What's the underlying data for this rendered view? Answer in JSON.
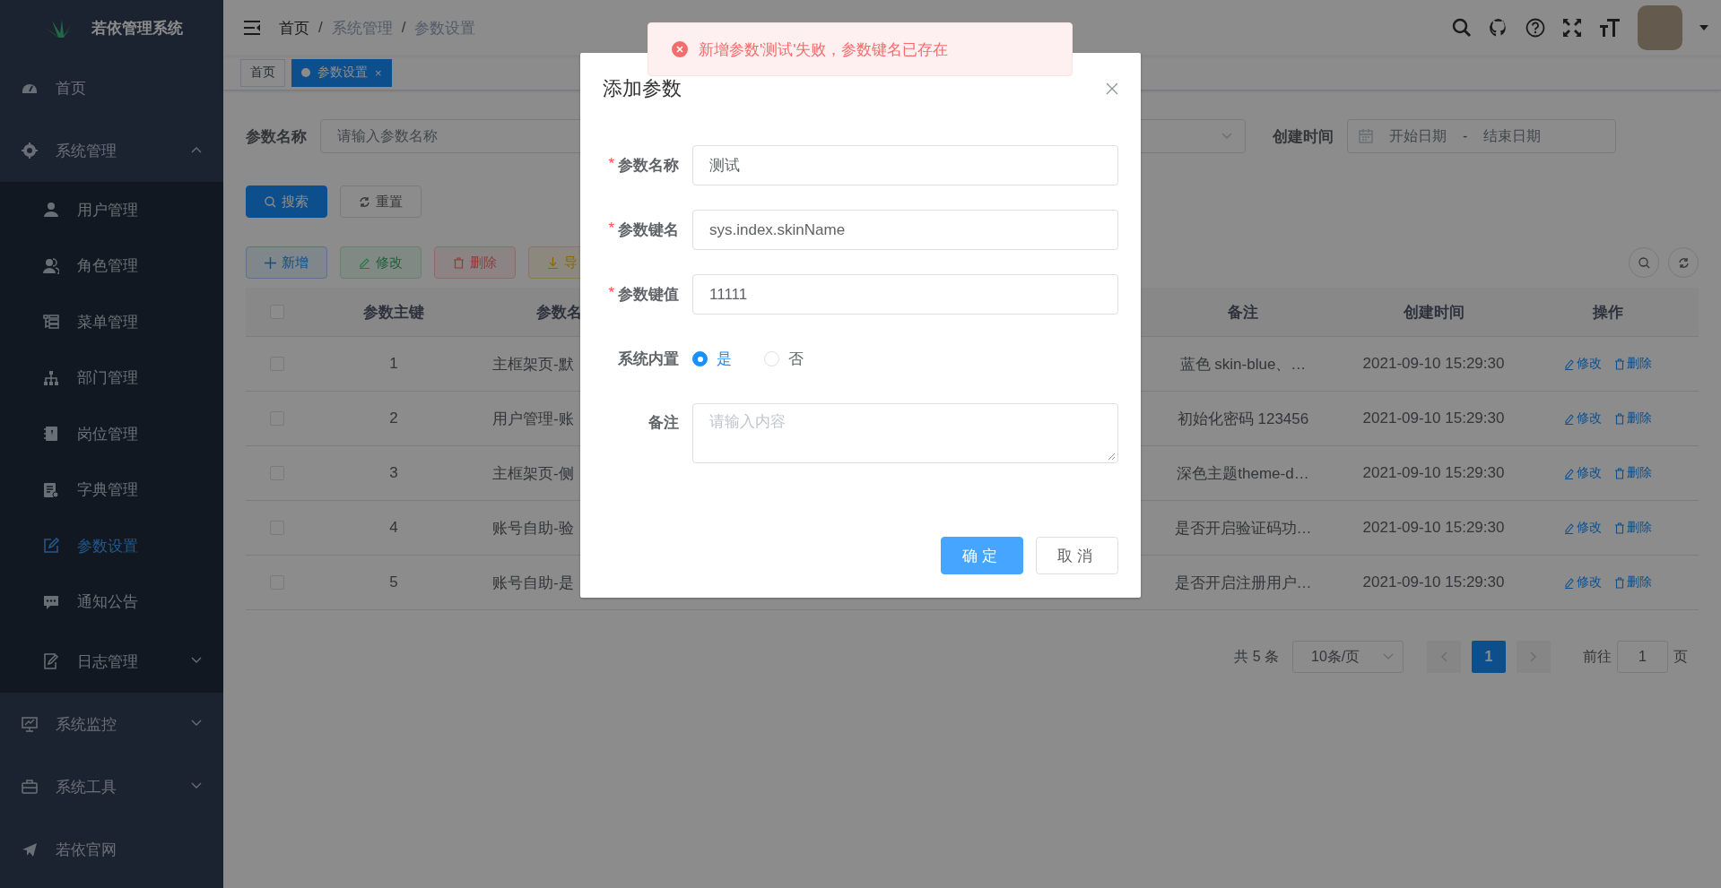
{
  "sidebar": {
    "logo_text": "若依管理系统",
    "items": [
      {
        "label": "首页",
        "selected": false
      },
      {
        "label": "系统管理",
        "selected": false,
        "expanded": true,
        "children": [
          {
            "label": "用户管理",
            "selected": false
          },
          {
            "label": "角色管理",
            "selected": false
          },
          {
            "label": "菜单管理",
            "selected": false
          },
          {
            "label": "部门管理",
            "selected": false
          },
          {
            "label": "岗位管理",
            "selected": false
          },
          {
            "label": "字典管理",
            "selected": false
          },
          {
            "label": "参数设置",
            "selected": true
          },
          {
            "label": "通知公告",
            "selected": false
          },
          {
            "label": "日志管理",
            "selected": false,
            "expanded": false
          }
        ]
      },
      {
        "label": "系统监控",
        "selected": false,
        "expanded": false
      },
      {
        "label": "系统工具",
        "selected": false,
        "expanded": false
      },
      {
        "label": "若依官网",
        "selected": false
      }
    ]
  },
  "breadcrumb": {
    "separator": "/",
    "items": [
      "首页",
      "系统管理",
      "参数设置"
    ]
  },
  "tags": [
    {
      "label": "首页",
      "selected": false
    },
    {
      "label": "参数设置",
      "selected": true,
      "close": "×"
    }
  ],
  "filter": {
    "name_label": "参数名称",
    "name_placeholder": "请输入参数名称",
    "time_label": "创建时间",
    "start_placeholder": "开始日期",
    "range_separator": "-",
    "end_placeholder": "结束日期"
  },
  "search_buttons": [
    {
      "label": "搜索",
      "kind": "primary"
    },
    {
      "label": "重置",
      "kind": "reset"
    }
  ],
  "toolbar": [
    {
      "label": "新增",
      "kind": "add",
      "disabled": false
    },
    {
      "label": "修改",
      "kind": "edit",
      "disabled": true
    },
    {
      "label": "删除",
      "kind": "delete",
      "disabled": true
    },
    {
      "label": "导",
      "kind": "export",
      "disabled": false
    }
  ],
  "table": {
    "header_checked": false,
    "columns": [
      "参数主键",
      "参数名",
      "备注",
      "创建时间",
      "操作"
    ],
    "rows": [
      {
        "checked": false,
        "id": "1",
        "name": "主框架页-默",
        "remark": "蓝色 skin-blue、…",
        "created": "2021-09-10 15:29:30",
        "edit": "修改",
        "delete": "删除"
      },
      {
        "checked": false,
        "id": "2",
        "name": "用户管理-账",
        "remark": "初始化密码 123456",
        "created": "2021-09-10 15:29:30",
        "edit": "修改",
        "delete": "删除"
      },
      {
        "checked": false,
        "id": "3",
        "name": "主框架页-侧",
        "remark": "深色主题theme-d…",
        "created": "2021-09-10 15:29:30",
        "edit": "修改",
        "delete": "删除"
      },
      {
        "checked": false,
        "id": "4",
        "name": "账号自助-验",
        "remark": "是否开启验证码功…",
        "created": "2021-09-10 15:29:30",
        "edit": "修改",
        "delete": "删除"
      },
      {
        "checked": false,
        "id": "5",
        "name": "账号自助-是",
        "remark": "是否开启注册用户…",
        "created": "2021-09-10 15:29:30",
        "edit": "修改",
        "delete": "删除"
      }
    ]
  },
  "pagination": {
    "total": "共 5 条",
    "page_size": "10条/页",
    "pages": [
      {
        "label": "1",
        "selected": true
      }
    ],
    "goto_label": "前往",
    "goto_value": "1",
    "goto_suffix": "页"
  },
  "dialog": {
    "title": "添加参数",
    "fields": [
      {
        "kind": "input",
        "label": "参数名称",
        "required_mark": "*",
        "value": "测试"
      },
      {
        "kind": "input",
        "label": "参数键名",
        "required_mark": "*",
        "value": "sys.index.skinName"
      },
      {
        "kind": "input",
        "label": "参数键值",
        "required_mark": "*",
        "value": "11111"
      },
      {
        "kind": "radio",
        "label": "系统内置",
        "options": [
          {
            "label": "是",
            "selected": true
          },
          {
            "label": "否",
            "selected": false
          }
        ]
      },
      {
        "kind": "textarea",
        "label": "备注",
        "placeholder": "请输入内容"
      }
    ],
    "buttons": [
      {
        "label": "确定",
        "kind": "primary"
      },
      {
        "label": "取消",
        "kind": "default"
      }
    ]
  },
  "toast": {
    "kind": "error",
    "message": "新增参数'测试'失败，参数键名已存在"
  }
}
